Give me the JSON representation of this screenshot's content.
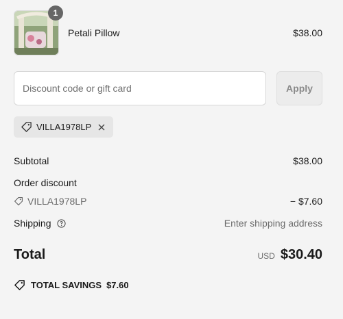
{
  "product": {
    "name": "Petali Pillow",
    "price": "$38.00",
    "quantity": "1"
  },
  "discount": {
    "placeholder": "Discount code or gift card",
    "apply_label": "Apply",
    "applied_code": "VILLA1978LP"
  },
  "summary": {
    "subtotal_label": "Subtotal",
    "subtotal_value": "$38.00",
    "order_discount_label": "Order discount",
    "discount_code": "VILLA1978LP",
    "discount_value": "− $7.60",
    "shipping_label": "Shipping",
    "shipping_value": "Enter shipping address",
    "total_label": "Total",
    "currency": "USD",
    "total_value": "$30.40",
    "savings_label": "TOTAL SAVINGS",
    "savings_value": "$7.60"
  },
  "icons": {
    "tag": "tag-icon",
    "close": "close-icon",
    "info": "info-icon",
    "savings": "savings-tag-icon"
  },
  "colors": {
    "background": "#f4f4f4",
    "badge": "#666666",
    "pill": "#e6e6e6"
  }
}
